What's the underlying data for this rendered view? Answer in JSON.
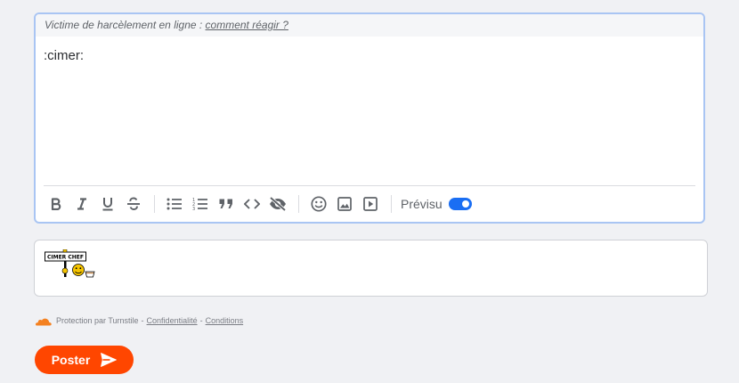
{
  "editor": {
    "notice_prefix": "Victime de harcèlement en ligne : ",
    "notice_link": "comment réagir ?",
    "text": ":cimer:",
    "toolbar": {
      "icons": [
        "bold-icon",
        "italic-icon",
        "underline-icon",
        "strikethrough-icon",
        "bullet-list-icon",
        "numbered-list-icon",
        "quote-icon",
        "code-icon",
        "spoiler-hidden-icon",
        "emoji-icon",
        "image-icon",
        "video-icon"
      ],
      "preview_label": "Prévisu",
      "preview_enabled": true
    }
  },
  "preview": {
    "smiley_sign_text": "CIMER CHEF"
  },
  "turnstile": {
    "protection_text": "Protection par Turnstile",
    "separator": "-",
    "privacy_link": "Confidentialité",
    "terms_link": "Conditions"
  },
  "post_button": {
    "label": "Poster"
  },
  "colors": {
    "accent": "#ff4600",
    "toggle": "#1a6ef3",
    "editor_border": "#a9c5f3",
    "cloud": "#f48120"
  }
}
